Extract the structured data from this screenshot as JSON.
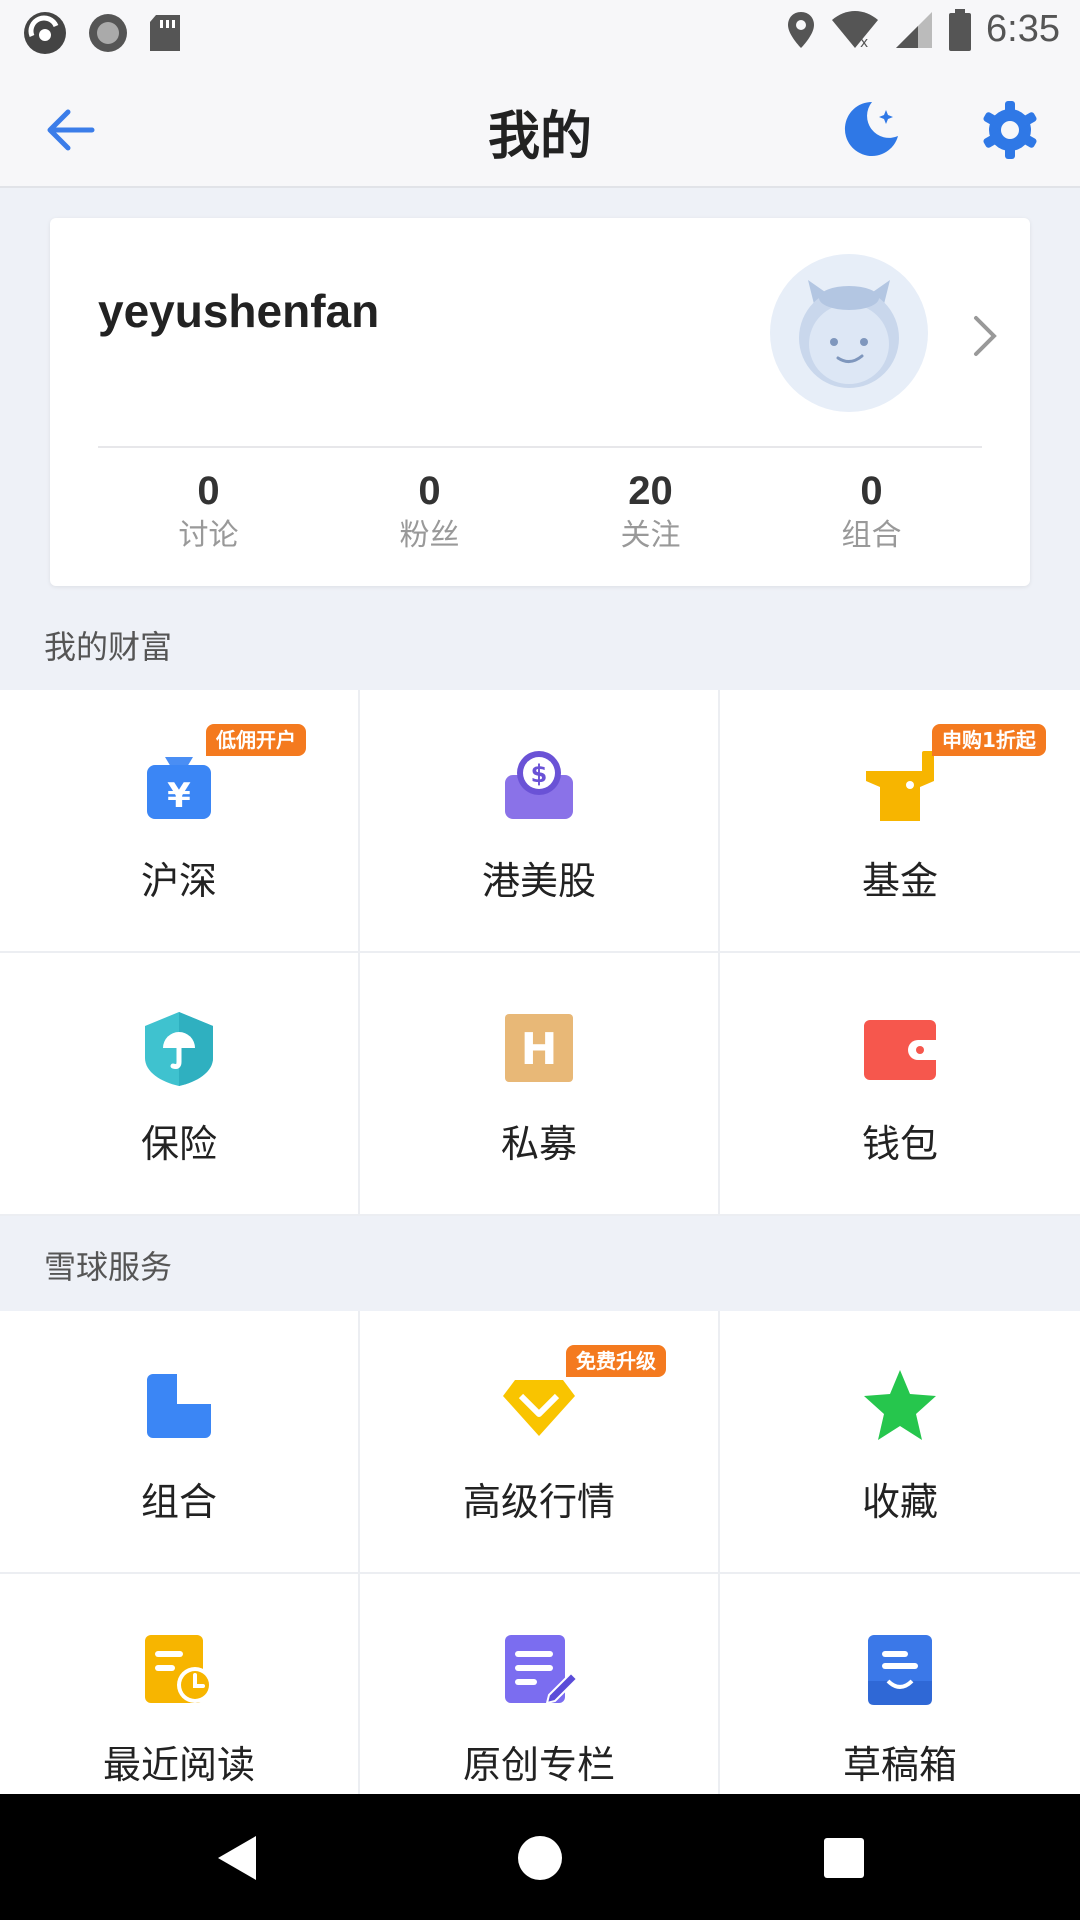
{
  "status_bar": {
    "time": "6:35",
    "icons": [
      "app-icon",
      "circle-icon",
      "sd-card-icon",
      "location-icon",
      "wifi-icon",
      "signal-icon",
      "battery-icon"
    ]
  },
  "header": {
    "title": "我的",
    "back_icon": "arrow-left-icon",
    "night_mode_icon": "moon-icon",
    "settings_icon": "gear-icon",
    "accent_color": "#3b7de9"
  },
  "profile": {
    "username": "yeyushenfan",
    "stats": [
      {
        "value": "0",
        "label": "讨论"
      },
      {
        "value": "0",
        "label": "粉丝"
      },
      {
        "value": "20",
        "label": "关注"
      },
      {
        "value": "0",
        "label": "组合"
      }
    ]
  },
  "wealth": {
    "title": "我的财富",
    "items": [
      {
        "label": "沪深",
        "icon": "yuan-bag-icon",
        "badge": "低佣开户"
      },
      {
        "label": "港美股",
        "icon": "dollar-icon",
        "badge": ""
      },
      {
        "label": "基金",
        "icon": "fund-pot-icon",
        "badge": "申购1折起"
      },
      {
        "label": "保险",
        "icon": "shield-umbrella-icon",
        "badge": ""
      },
      {
        "label": "私募",
        "icon": "h-square-icon",
        "badge": ""
      },
      {
        "label": "钱包",
        "icon": "wallet-icon",
        "badge": ""
      }
    ]
  },
  "services": {
    "title": "雪球服务",
    "items": [
      {
        "label": "组合",
        "icon": "portfolio-icon",
        "badge": ""
      },
      {
        "label": "高级行情",
        "icon": "diamond-icon",
        "badge": "免费升级"
      },
      {
        "label": "收藏",
        "icon": "star-icon",
        "badge": ""
      },
      {
        "label": "最近阅读",
        "icon": "recent-read-icon",
        "badge": ""
      },
      {
        "label": "原创专栏",
        "icon": "article-edit-icon",
        "badge": ""
      },
      {
        "label": "草稿箱",
        "icon": "drafts-icon",
        "badge": ""
      }
    ]
  },
  "nav_bar": {
    "icons": [
      "back-triangle-icon",
      "home-circle-icon",
      "recents-square-icon"
    ]
  }
}
